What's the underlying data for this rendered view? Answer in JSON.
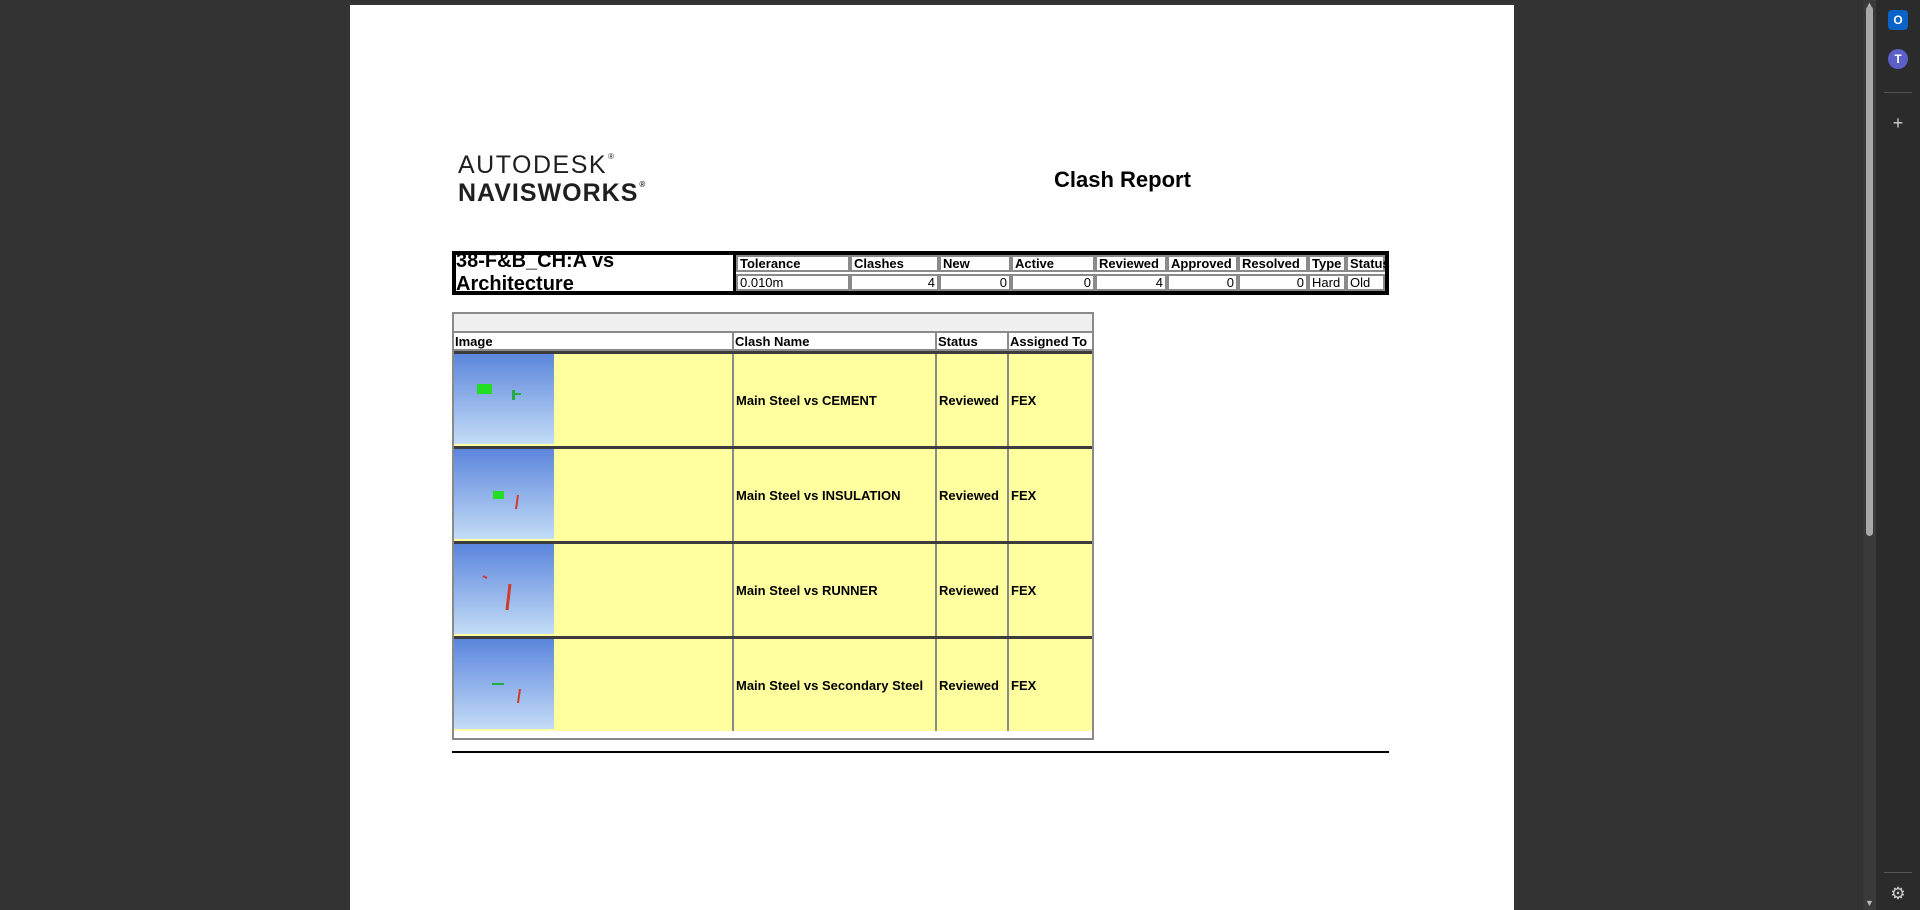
{
  "logo": {
    "line1": "AUTODESK",
    "line2": "NAVISWORKS",
    "mark": "®"
  },
  "report_title": "Clash Report",
  "summary": {
    "test_name": "38-F&B_CH:A vs Architecture",
    "headers": [
      "Tolerance",
      "Clashes",
      "New",
      "Active",
      "Reviewed",
      "Approved",
      "Resolved",
      "Type",
      "Status"
    ],
    "values": [
      "0.010m",
      "4",
      "0",
      "0",
      "4",
      "0",
      "0",
      "Hard",
      "Old"
    ]
  },
  "clash_table": {
    "headers": {
      "image": "Image",
      "clash_name": "Clash Name",
      "status": "Status",
      "assigned_to": "Assigned To"
    },
    "rows": [
      {
        "name": "Main Steel vs CEMENT",
        "status": "Reviewed",
        "assigned": "FEX"
      },
      {
        "name": "Main Steel vs INSULATION",
        "status": "Reviewed",
        "assigned": "FEX"
      },
      {
        "name": "Main Steel vs RUNNER",
        "status": "Reviewed",
        "assigned": "FEX"
      },
      {
        "name": "Main Steel vs Secondary Steel",
        "status": "Reviewed",
        "assigned": "FEX"
      }
    ]
  },
  "sidebar": {
    "icons": [
      "outlook-icon",
      "teams-icon",
      "add-icon",
      "settings-icon"
    ],
    "outlook_glyph": "O",
    "teams_glyph": "T",
    "add_glyph": "+",
    "settings_glyph": "⚙"
  },
  "scrollbar": {
    "up_glyph": "▲",
    "down_glyph": "▼"
  },
  "colors": {
    "row_fill": "#ffff9f",
    "background": "#333333",
    "page": "#ffffff"
  }
}
